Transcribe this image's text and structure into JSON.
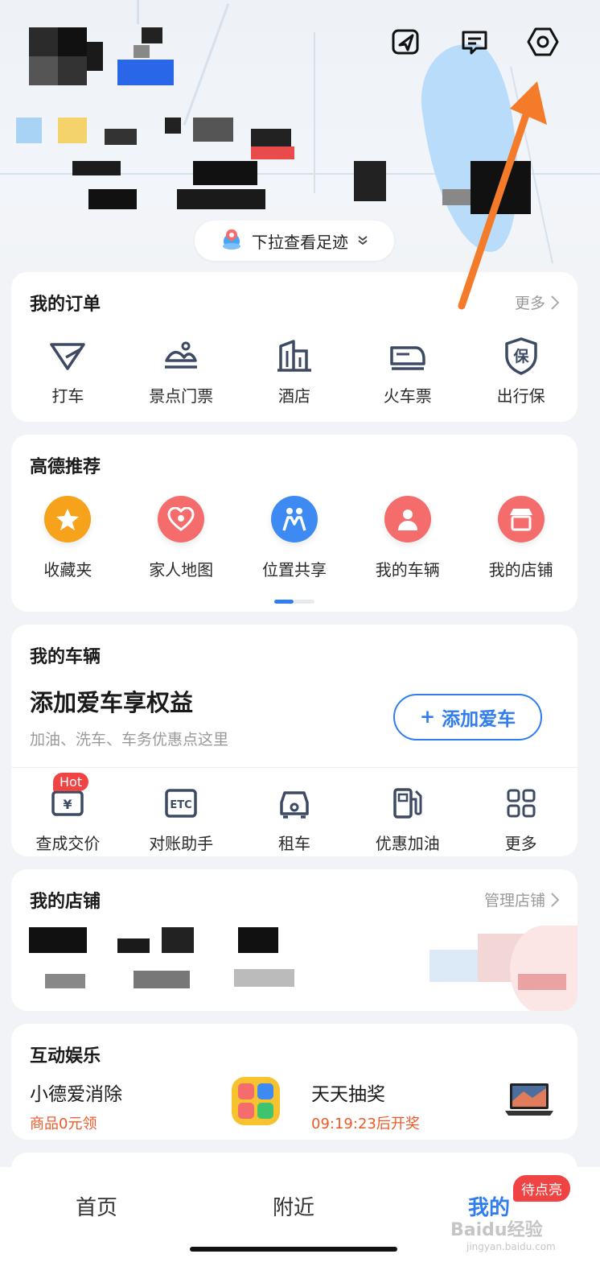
{
  "header": {
    "pull_footprint_label": "下拉查看足迹",
    "icons": [
      "send-icon",
      "message-icon",
      "settings-icon"
    ]
  },
  "orders": {
    "title": "我的订单",
    "more_label": "更多",
    "items": [
      {
        "label": "打车",
        "icon": "taxi-icon"
      },
      {
        "label": "景点门票",
        "icon": "scenic-ticket-icon"
      },
      {
        "label": "酒店",
        "icon": "hotel-icon"
      },
      {
        "label": "火车票",
        "icon": "train-ticket-icon"
      },
      {
        "label": "出行保",
        "icon": "travel-insurance-icon"
      }
    ]
  },
  "recommend": {
    "title": "高德推荐",
    "items": [
      {
        "label": "收藏夹",
        "icon": "star-icon",
        "color": "#f7a21b"
      },
      {
        "label": "家人地图",
        "icon": "family-heart-icon",
        "color": "#f56c6c"
      },
      {
        "label": "位置共享",
        "icon": "location-share-icon",
        "color": "#3d8bf2"
      },
      {
        "label": "我的车辆",
        "icon": "person-car-icon",
        "color": "#f56c6c"
      },
      {
        "label": "我的店铺",
        "icon": "store-icon",
        "color": "#f56c6c"
      }
    ],
    "page_indicator": {
      "current": 1,
      "total": 2
    }
  },
  "vehicle": {
    "title": "我的车辆",
    "promo_title": "添加爱车享权益",
    "promo_subtitle": "加油、洗车、车务优惠点这里",
    "add_button_plus": "+",
    "add_button_label": "添加爱车",
    "tools": [
      {
        "label": "查成交价",
        "icon": "price-check-icon",
        "badge": "Hot"
      },
      {
        "label": "对账助手",
        "icon": "etc-icon"
      },
      {
        "label": "租车",
        "icon": "car-rental-icon"
      },
      {
        "label": "优惠加油",
        "icon": "fuel-pump-icon"
      },
      {
        "label": "更多",
        "icon": "grid-more-icon"
      }
    ]
  },
  "store": {
    "title": "我的店铺",
    "manage_label": "管理店铺"
  },
  "entertainment": {
    "title": "互动娱乐",
    "items": [
      {
        "title": "小德爱消除",
        "subtitle": "商品0元领",
        "icon": "game-app-icon"
      },
      {
        "title": "天天抽奖",
        "subtitle": "09:19:23后开奖",
        "icon": "laptop-prize-icon"
      }
    ]
  },
  "bottom_nav": {
    "items": [
      {
        "label": "首页"
      },
      {
        "label": "附近"
      },
      {
        "label": "我的",
        "active": true
      }
    ],
    "badge": "待点亮"
  },
  "watermark": {
    "text": "Baidu经验",
    "sub": "jingyan.baidu.com"
  },
  "colors": {
    "accent": "#2f7df0",
    "hot_red": "#f04444",
    "orange_arrow": "#f47b2a",
    "countdown": "#f05a28"
  }
}
